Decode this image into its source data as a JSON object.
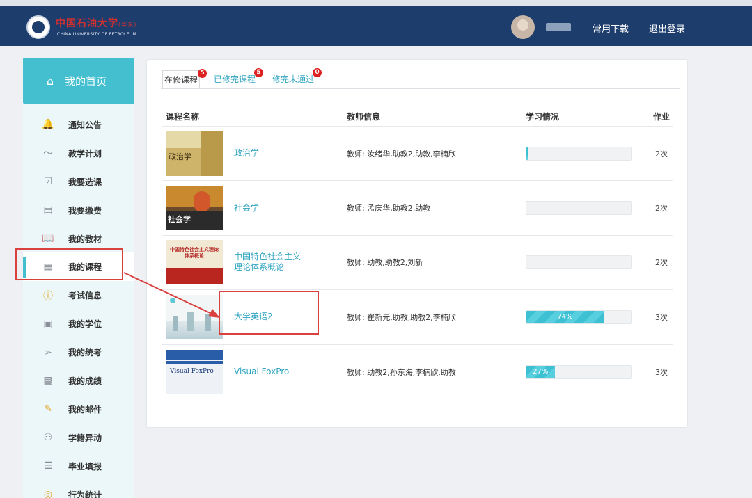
{
  "header": {
    "brand_cn": "中国石油大学",
    "brand_cn_suffix": "(华东)",
    "brand_en": "CHINA UNIVERSITY OF PETROLEUM",
    "downloads_label": "常用下载",
    "logout_label": "退出登录"
  },
  "sidebar": {
    "home_label": "我的首页",
    "items": [
      {
        "label": "通知公告",
        "icon": "bell-icon",
        "glyph": "🔔"
      },
      {
        "label": "教学计划",
        "icon": "chart-icon",
        "glyph": "〜"
      },
      {
        "label": "我要选课",
        "icon": "checkbox-icon",
        "glyph": "☑"
      },
      {
        "label": "我要缴费",
        "icon": "payment-icon",
        "glyph": "▤"
      },
      {
        "label": "我的教材",
        "icon": "book-icon",
        "glyph": "📖"
      },
      {
        "label": "我的课程",
        "icon": "grid-icon",
        "glyph": "▦"
      },
      {
        "label": "考试信息",
        "icon": "info-icon",
        "glyph": "ⓘ"
      },
      {
        "label": "我的学位",
        "icon": "degree-icon",
        "glyph": "▣"
      },
      {
        "label": "我的统考",
        "icon": "send-icon",
        "glyph": "➢"
      },
      {
        "label": "我的成绩",
        "icon": "score-icon",
        "glyph": "▩"
      },
      {
        "label": "我的邮件",
        "icon": "mail-icon",
        "glyph": "✎"
      },
      {
        "label": "学籍异动",
        "icon": "users-icon",
        "glyph": "⚇"
      },
      {
        "label": "毕业填报",
        "icon": "form-icon",
        "glyph": "☰"
      },
      {
        "label": "行为统计",
        "icon": "compass-icon",
        "glyph": "◎"
      }
    ]
  },
  "tabs": [
    {
      "label": "在修课程",
      "count": "5"
    },
    {
      "label": "已修完课程",
      "count": "5"
    },
    {
      "label": "修完未通过",
      "count": "0"
    }
  ],
  "table": {
    "headers": [
      "课程名称",
      "教师信息",
      "学习情况",
      "作业"
    ],
    "rows": [
      {
        "name": "政治学",
        "teacher": "教师: 汝绪华,助教2,助教,李楠欣",
        "progress_label": "",
        "progress": 2,
        "homework": "2次",
        "cover_title": "政治学"
      },
      {
        "name": "社会学",
        "teacher": "教师: 孟庆华,助教2,助教",
        "progress_label": "",
        "progress": 0,
        "homework": "2次",
        "cover_title": "社会学"
      },
      {
        "name": "中国特色社会主义理论体系概论",
        "teacher": "教师: 助教,助教2,刘新",
        "progress_label": "",
        "progress": 0,
        "homework": "2次",
        "cover_title": "中国特色社会主义理论体系概论"
      },
      {
        "name": "大学英语2",
        "teacher": "教师: 崔新元,助教,助教2,李楠欣",
        "progress_label": "74%",
        "progress": 74,
        "homework": "3次",
        "cover_title": ""
      },
      {
        "name": "Visual FoxPro",
        "teacher": "教师: 助教2,孙东海,李楠欣,助教",
        "progress_label": "27%",
        "progress": 27,
        "homework": "3次",
        "cover_title": "Visual FoxPro"
      }
    ]
  },
  "colors": {
    "accent": "#43bfd0",
    "header": "#1d3d6d",
    "highlight": "#d9413f",
    "badge": "#dd2222"
  }
}
